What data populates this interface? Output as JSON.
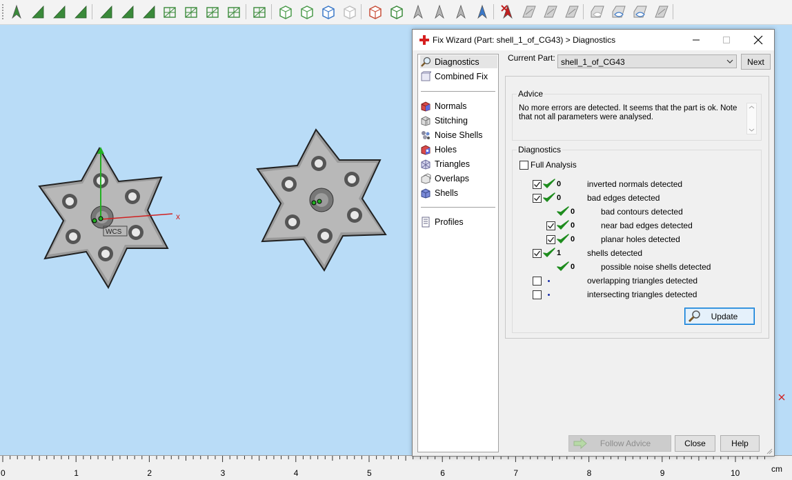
{
  "toolbar": {
    "icons": [
      "arrow-tool-icon",
      "select-surface-icon",
      "select-curve-icon",
      "select-circle-icon",
      "select-rect-icon",
      "select-shell-icon",
      "select-line-icon",
      "mesh-select-icon",
      "mesh-brush-icon",
      "mesh-lasso-icon",
      "mesh-wheel-icon",
      "mesh-wrench-icon",
      "cube-view-icon",
      "cube-top-icon",
      "cube-color-icon",
      "cube-wire-icon",
      "cube-red-icon",
      "cube-green-icon",
      "arrow-gray-icon",
      "arrow-gray-2-icon",
      "arrow-gray-3-icon",
      "arrow-blue-icon",
      "arrow-red-x-icon",
      "plane-gray-icon",
      "plane-gray-2-icon",
      "plane-gray-3-icon",
      "eye-icon",
      "eye-gear-icon",
      "eye-blue-icon",
      "plane-gray-4-icon"
    ]
  },
  "viewport": {
    "axis_x_label": "x",
    "wcs_label": "WCS"
  },
  "ruler": {
    "ticks": [
      "0",
      "1",
      "2",
      "3",
      "4",
      "5",
      "6",
      "7",
      "8",
      "9",
      "10"
    ],
    "unit": "cm"
  },
  "dialog": {
    "title": "Fix Wizard (Part: shell_1_of_CG43) > Diagnostics",
    "nav_top": [
      {
        "label": "Diagnostics",
        "icon": "magnifier-icon",
        "selected": true
      },
      {
        "label": "Combined Fix",
        "icon": "combined-fix-icon",
        "selected": false
      }
    ],
    "nav_mid": [
      {
        "label": "Normals",
        "icon": "normals-icon"
      },
      {
        "label": "Stitching",
        "icon": "stitching-icon"
      },
      {
        "label": "Noise Shells",
        "icon": "noise-shells-icon"
      },
      {
        "label": "Holes",
        "icon": "holes-icon"
      },
      {
        "label": "Triangles",
        "icon": "triangles-icon"
      },
      {
        "label": "Overlaps",
        "icon": "overlaps-icon"
      },
      {
        "label": "Shells",
        "icon": "shells-icon"
      }
    ],
    "nav_bottom": [
      {
        "label": "Profiles",
        "icon": "profiles-icon"
      }
    ],
    "current_part_label": "Current Part:",
    "current_part_value": "shell_1_of_CG43",
    "next_label": "Next",
    "advice_title": "Advice",
    "advice_text": "No more errors are detected. It seems that the part is ok. Note that not all parameters were analysed.",
    "diagnostics_title": "Diagnostics",
    "full_analysis_label": "Full Analysis",
    "full_analysis_checked": false,
    "rows": [
      {
        "checkbox": true,
        "checked": true,
        "status": "ok",
        "count": "0",
        "label": "inverted normals detected",
        "indent": 0
      },
      {
        "checkbox": true,
        "checked": true,
        "status": "ok",
        "count": "0",
        "label": "bad edges detected",
        "indent": 0
      },
      {
        "checkbox": false,
        "checked": false,
        "status": "ok",
        "count": "0",
        "label": "bad contours detected",
        "indent": 1
      },
      {
        "checkbox": true,
        "checked": true,
        "status": "ok",
        "count": "0",
        "label": "near bad edges detected",
        "indent": 1
      },
      {
        "checkbox": true,
        "checked": true,
        "status": "ok",
        "count": "0",
        "label": "planar holes detected",
        "indent": 1
      },
      {
        "checkbox": true,
        "checked": true,
        "status": "ok",
        "count": "1",
        "label": "shells detected",
        "indent": 0
      },
      {
        "checkbox": false,
        "checked": false,
        "status": "ok",
        "count": "0",
        "label": "possible noise shells detected",
        "indent": 1
      },
      {
        "checkbox": true,
        "checked": false,
        "status": "pending",
        "count": "",
        "label": "overlapping triangles detected",
        "indent": 0
      },
      {
        "checkbox": true,
        "checked": false,
        "status": "pending",
        "count": "",
        "label": "intersecting triangles detected",
        "indent": 0
      }
    ],
    "update_label": "Update",
    "follow_advice_label": "Follow Advice",
    "close_label": "Close",
    "help_label": "Help"
  },
  "colors": {
    "viewport_bg": "#b9dcf7",
    "ok_tick": "#1e8c1e",
    "pending_dot": "#1a2fa8",
    "axis_x": "#d02020",
    "axis_y": "#22b022"
  }
}
